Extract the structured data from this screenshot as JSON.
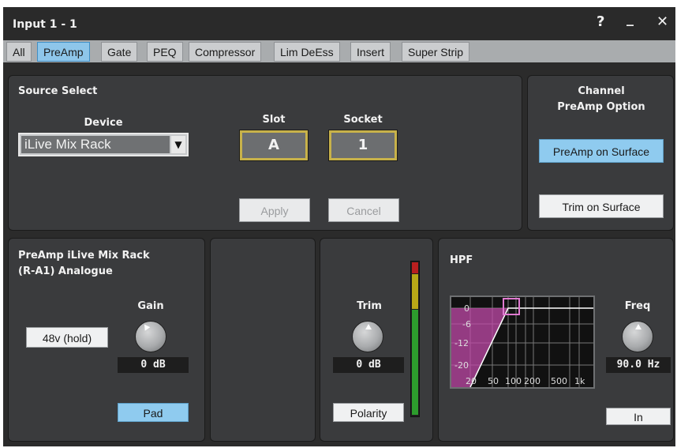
{
  "window": {
    "title": "Input 1 - 1",
    "help_icon": "?",
    "minimize_icon": "_",
    "close_icon": "✕"
  },
  "tabs": [
    {
      "label": "All",
      "active": false
    },
    {
      "label": "PreAmp",
      "active": true
    },
    {
      "label": "Gate",
      "active": false
    },
    {
      "label": "PEQ",
      "active": false
    },
    {
      "label": "Compressor",
      "active": false
    },
    {
      "label": "Lim DeEss",
      "active": false
    },
    {
      "label": "Insert",
      "active": false
    },
    {
      "label": "Super Strip",
      "active": false
    }
  ],
  "source_select": {
    "title": "Source Select",
    "device_label": "Device",
    "device_value": "iLive Mix Rack",
    "slot_label": "Slot",
    "slot_value": "A",
    "socket_label": "Socket",
    "socket_value": "1",
    "apply_label": "Apply",
    "cancel_label": "Cancel"
  },
  "channel_option": {
    "title_line1": "Channel",
    "title_line2": "PreAmp Option",
    "preamp_on_surface": "PreAmp on Surface",
    "trim_on_surface": "Trim on Surface"
  },
  "preamp": {
    "title_line1": "PreAmp iLive Mix Rack",
    "title_line2": "(R-A1) Analogue",
    "phantom_label": "48v (hold)",
    "gain_label": "Gain",
    "gain_value": "0 dB",
    "pad_label": "Pad"
  },
  "trim": {
    "label": "Trim",
    "value": "0 dB",
    "polarity_label": "Polarity"
  },
  "hpf": {
    "title": "HPF",
    "freq_label": "Freq",
    "freq_value": "90.0 Hz",
    "in_label": "In",
    "y_ticks": [
      "0",
      "-6",
      "-12",
      "-20"
    ],
    "x_ticks": [
      "20",
      "50",
      "100",
      "200",
      "500",
      "1k"
    ],
    "curve_color": "#c04aa8"
  },
  "colors": {
    "accent_blue": "#8ec6ea",
    "slot_border": "#c8b24a",
    "meter_red": "#b81f1f",
    "meter_yellow": "#b8a817",
    "meter_green": "#2d9c2d"
  }
}
